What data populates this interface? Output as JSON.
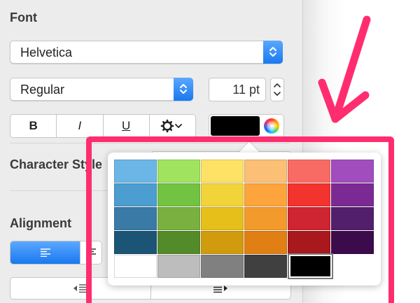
{
  "font": {
    "heading": "Font",
    "family": "Helvetica",
    "typeface": "Regular",
    "size": "11 pt",
    "style_buttons": [
      "B",
      "I",
      "U"
    ],
    "options_icon": "gear-icon",
    "text_color": "#000000"
  },
  "character_style": {
    "heading": "Character Style"
  },
  "alignment": {
    "heading": "Alignment"
  },
  "palette": {
    "rows": [
      [
        "#6bb6e6",
        "#a0e35f",
        "#fde265",
        "#fbbf75",
        "#f86b65",
        "#a24dbe"
      ],
      [
        "#4c9dd0",
        "#72c341",
        "#f2d33a",
        "#fda43c",
        "#f3332e",
        "#7b2a93"
      ],
      [
        "#3a7aa6",
        "#7ab040",
        "#e6bf1a",
        "#f29a2b",
        "#cf2431",
        "#521f6c"
      ],
      [
        "#1c5475",
        "#548b2a",
        "#d09b0c",
        "#e07f14",
        "#a8181c",
        "#3c0b4c"
      ],
      [
        "#ffffff",
        "#bdbdbd",
        "#808080",
        "#404040",
        "#000000"
      ]
    ],
    "selected": "#000000"
  },
  "annotation": {
    "color": "#ff2d70"
  }
}
